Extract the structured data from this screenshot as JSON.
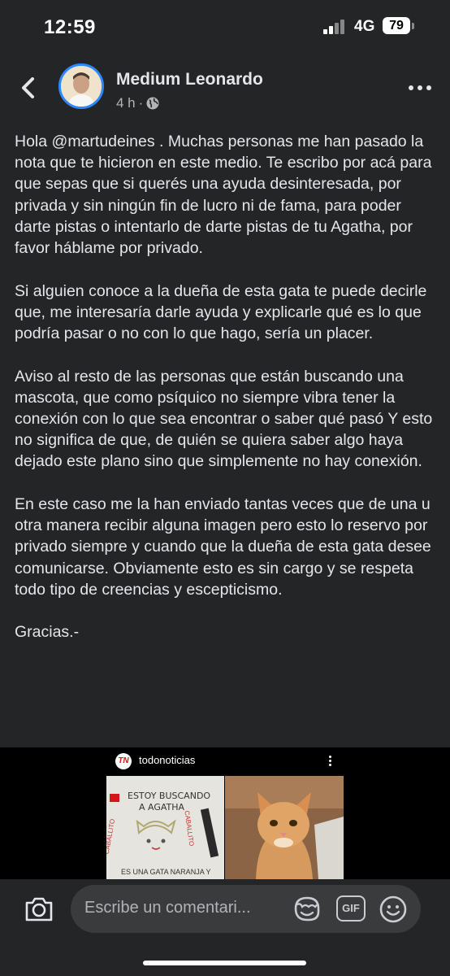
{
  "status_bar": {
    "time": "12:59",
    "network": "4G",
    "battery": "79"
  },
  "post": {
    "author": "Medium Leonardo",
    "time_ago": "4 h",
    "separator": "·",
    "paragraphs": [
      "Hola @martudeines . Muchas personas me han pasado la nota que te hicieron en este medio. Te escribo por acá para que sepas que si querés una ayuda desinteresada, por privada y sin ningún fin de lucro ni de fama, para poder darte pistas o intentarlo de darte pistas de tu Agatha, por favor háblame por privado.",
      "Si alguien conoce a la dueña de esta gata te puede decirle que, me interesaría darle ayuda y explicarle qué es lo que podría pasar o no con lo que hago, sería un placer.",
      "Aviso al resto de las personas que están buscando una mascota, que como psíquico no siempre vibra tener la conexión con lo que sea encontrar o saber qué pasó Y esto no significa de que, de quién se quiera saber algo haya dejado este plano sino que simplemente no hay conexión.",
      "En este caso me la han enviado tantas veces que de una u otra manera recibir alguna imagen pero esto lo reservo por privado siempre y cuando que la dueña de esta gata desee comunicarse. Obviamente esto es sin cargo y se respeta todo tipo de creencias y escepticismo.",
      "Gracias.-"
    ]
  },
  "embed": {
    "logo_text": "TN",
    "account": "todonoticias",
    "sign_line1": "ESTOY BUSCANDO",
    "sign_line2": "A AGATHA",
    "sign_side_left": "CABALLITO",
    "sign_side_right": "CABALLITO",
    "sign_bottom": "ES UNA GATA NARANJA Y"
  },
  "comment_bar": {
    "placeholder": "Escribe un comentari...",
    "gif_label": "GIF"
  },
  "colors": {
    "background": "#242526",
    "accent": "#2d88ff",
    "input": "#3a3b3c"
  },
  "icons": [
    "back-chevron-icon",
    "globe-icon",
    "more-dots-icon",
    "camera-icon",
    "sticker-icon",
    "gif-icon",
    "emoji-icon"
  ]
}
